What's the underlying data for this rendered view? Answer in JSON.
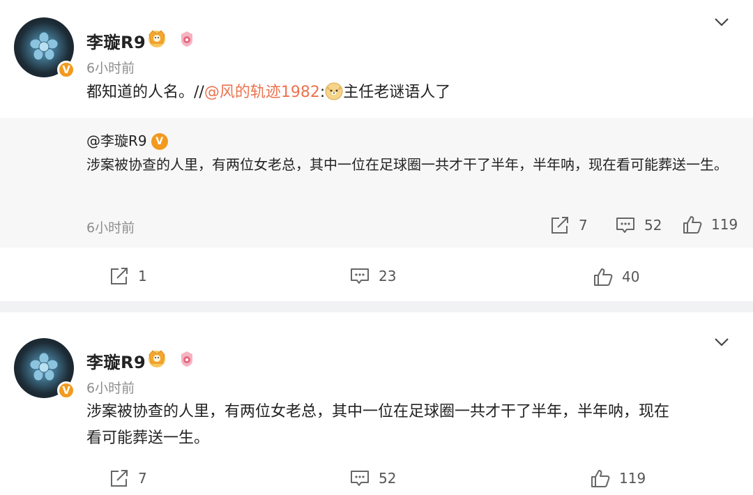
{
  "post1": {
    "username": "李璇R9",
    "time": "6小时前",
    "content_prefix": "都知道的人名。//",
    "mention": "@风的轨迹1982",
    "colon": ":",
    "content_suffix": "主任老谜语人了",
    "quote": {
      "author": "@李璇R9",
      "verified_badge": "V",
      "text": "涉案被协查的人里，有两位女老总，其中一位在足球圈一共才干了半年，半年呐，现在看可能葬送一生。",
      "time": "6小时前",
      "reposts": "7",
      "comments": "52",
      "likes": "119"
    },
    "reposts": "1",
    "comments": "23",
    "likes": "40"
  },
  "post2": {
    "username": "李璇R9",
    "time": "6小时前",
    "content_line1": "涉案被协查的人里，有两位女老总，其中一位在足球圈一共才干了半年，半年呐，现在",
    "content_line2": "看可能葬送一生。",
    "reposts": "7",
    "comments": "52",
    "likes": "119"
  },
  "verified_badge": "V",
  "icons": {
    "repost": "repost-icon",
    "comment": "comment-icon",
    "like": "thumbs-up-icon",
    "more": "chevron-down-icon",
    "crown": "crown-badge-icon",
    "level": "level-badge-icon",
    "emoji": "doge-emoji-icon"
  },
  "colors": {
    "mention": "#eb7350",
    "verified": "#f29a1f",
    "timestamp": "#8d8d8d",
    "quote_bg": "#f7f7f7",
    "separator": "#f1f2f4"
  }
}
